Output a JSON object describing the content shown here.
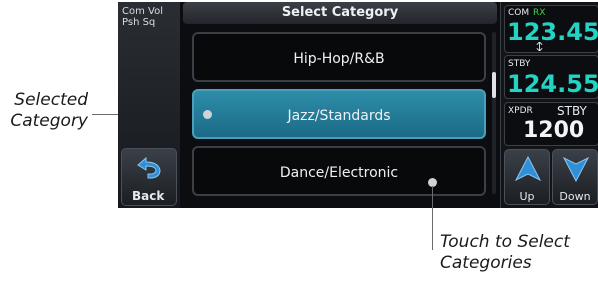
{
  "left_panel": {
    "com_vol_line1": "Com Vol",
    "com_vol_line2": "Psh Sq",
    "back_label": "Back"
  },
  "list": {
    "header": "Select Category",
    "items": [
      {
        "label": "Hip-Hop/R&B",
        "selected": false
      },
      {
        "label": "Jazz/Standards",
        "selected": true
      },
      {
        "label": "Dance/Electronic",
        "selected": false
      }
    ]
  },
  "right_panel": {
    "com_label": "COM",
    "rx_label": "RX",
    "com_freq": "123.45",
    "stby_label": "STBY",
    "stby_freq": "124.55",
    "xpdr_label": "XPDR",
    "xpdr_mode": "STBY",
    "xpdr_code": "1200",
    "up_label": "Up",
    "down_label": "Down"
  },
  "callouts": {
    "selected_line1": "Selected",
    "selected_line2": "Category",
    "touch_line1": "Touch to Select",
    "touch_line2": "Categories"
  },
  "colors": {
    "selected_teal": "#1b6b87",
    "freq_cyan": "#23d4c4",
    "rx_green": "#3fd24a"
  }
}
